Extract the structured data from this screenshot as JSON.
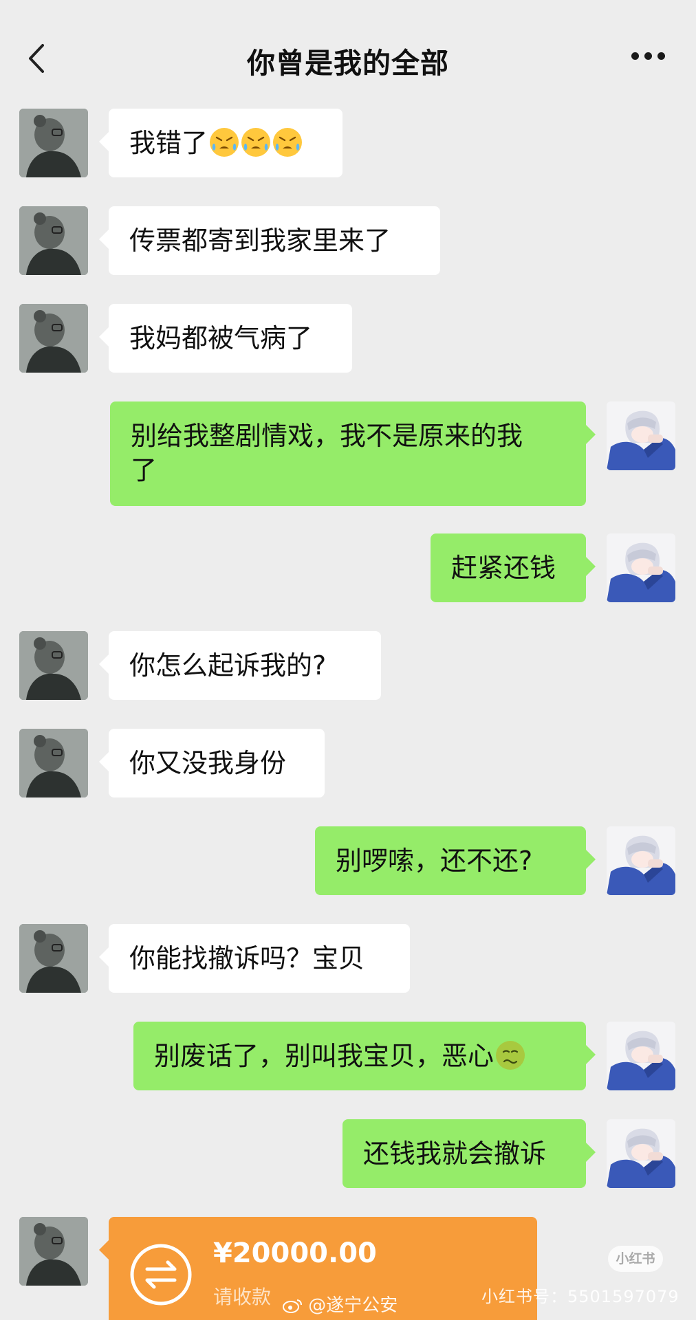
{
  "header": {
    "title": "你曾是我的全部",
    "back_icon": "chevron-left-icon",
    "more_icon": "more-dots-icon"
  },
  "messages": [
    {
      "side": "left",
      "lines": [
        "我错了"
      ],
      "emoji": [
        "tear-face-emoji",
        "tear-face-emoji",
        "tear-face-emoji"
      ]
    },
    {
      "side": "left",
      "lines": [
        "传票都寄到我家里来了"
      ]
    },
    {
      "side": "left",
      "lines": [
        "我妈都被气病了"
      ]
    },
    {
      "side": "right",
      "lines": [
        "别给我整剧情戏，我不是原来的我",
        "了"
      ]
    },
    {
      "side": "right",
      "lines": [
        "赶紧还钱"
      ]
    },
    {
      "side": "left",
      "lines": [
        "你怎么起诉我的?"
      ]
    },
    {
      "side": "left",
      "lines": [
        "你又没我身份"
      ]
    },
    {
      "side": "right",
      "lines": [
        "别啰嗦，还不还?"
      ]
    },
    {
      "side": "left",
      "lines": [
        "你能找撤诉吗？宝贝"
      ]
    },
    {
      "side": "right",
      "lines": [
        "别废话了，别叫我宝贝，恶心"
      ],
      "emoji": [
        "nauseated-face-emoji"
      ]
    },
    {
      "side": "right",
      "lines": [
        "还钱我就会撤诉"
      ]
    }
  ],
  "transfer": {
    "amount": "¥20000.00",
    "label": "请收款",
    "icon": "transfer-arrows-icon",
    "color": "#f79c3a"
  },
  "watermarks": {
    "badge": "小红书",
    "id_text": "小红书号：5501597079",
    "weibo": "@遂宁公安"
  },
  "colors": {
    "background": "#ededed",
    "incoming_bubble": "#ffffff",
    "outgoing_bubble": "#95ec69"
  }
}
